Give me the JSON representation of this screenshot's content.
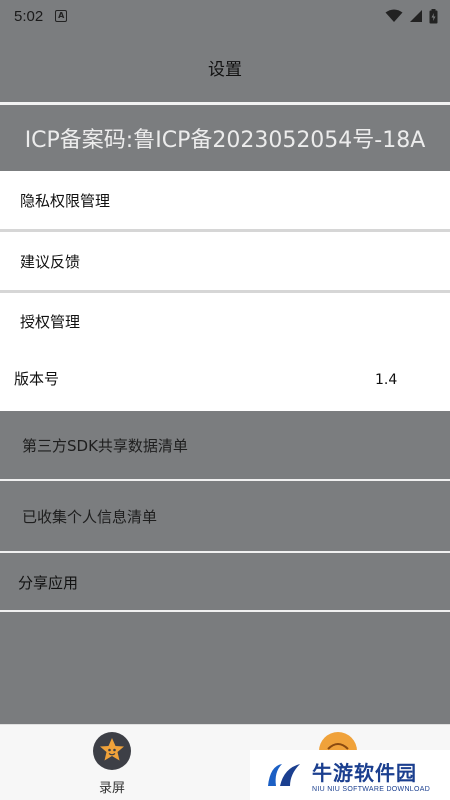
{
  "status_bar": {
    "time": "5:02"
  },
  "header": {
    "title": "设置"
  },
  "icp": {
    "text": "ICP备案码:鲁ICP备2023052054号-18A"
  },
  "settings": {
    "privacy": "隐私权限管理",
    "feedback": "建议反馈",
    "authorization": "授权管理",
    "version_label": "版本号",
    "version_value": "1.4",
    "sdk_list": "第三方SDK共享数据清单",
    "personal_info": "已收集个人信息清单",
    "share": "分享应用"
  },
  "bottom_nav": {
    "record_label": "录屏",
    "record_icon": "star-flame-icon",
    "second_icon": "orange-icon"
  },
  "watermark": {
    "main": "牛游软件园",
    "sub": "NIU NIU SOFTWARE DOWNLOAD"
  },
  "colors": {
    "overlay_gray": "#7b7d7f",
    "white": "#ffffff",
    "watermark_blue": "#1b3f8f"
  }
}
